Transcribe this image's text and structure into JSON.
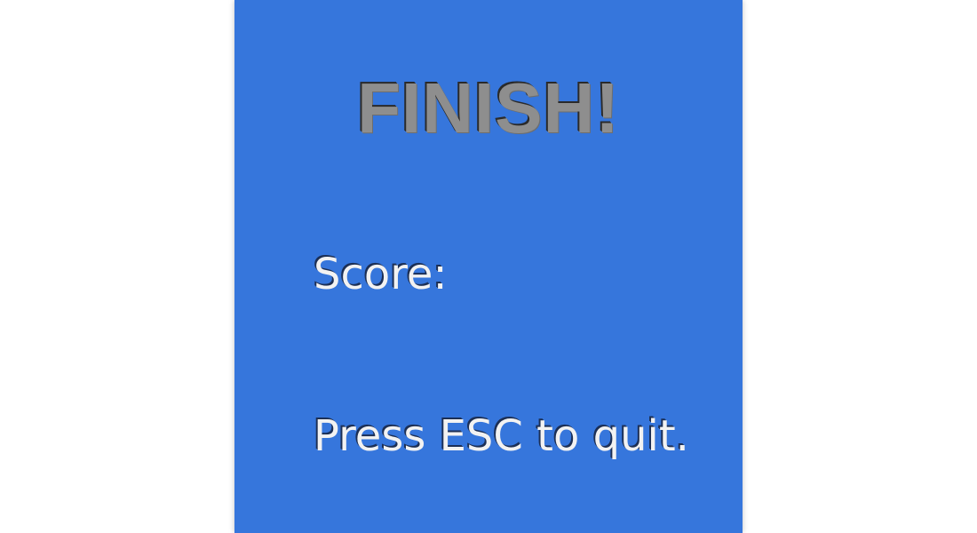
{
  "game": {
    "title": "FINISH!",
    "score_label": "Score:",
    "score_value": "",
    "quit_hint": "Press ESC to quit."
  },
  "colors": {
    "panel_background": "#3676dc",
    "page_background": "#ffffff",
    "title_color": "#8e8e8e",
    "text_color": "#f2f2f2"
  }
}
